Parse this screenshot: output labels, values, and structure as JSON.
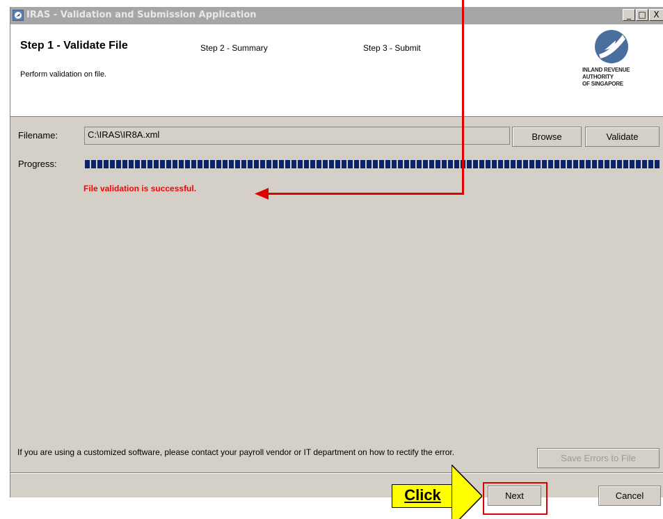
{
  "window": {
    "title": "IRAS - Validation and Submission Application",
    "controls": {
      "minimize": "_",
      "maximize": "□",
      "close": "X"
    }
  },
  "header": {
    "step1": "Step 1 - Validate File",
    "step2": "Step 2 - Summary",
    "step3": "Step 3 - Submit",
    "subtitle": "Perform validation on file.",
    "logo_lines": [
      "INLAND REVENUE",
      "AUTHORITY",
      "OF SINGAPORE"
    ]
  },
  "form": {
    "filename_label": "Filename:",
    "filename_value": "C:\\IRAS\\IR8A.xml",
    "browse_label": "Browse",
    "validate_label": "Validate",
    "progress_label": "Progress:",
    "progress_fraction": 1.0,
    "status_message": "File validation is successful."
  },
  "footer": {
    "info_text": "If you are using a customized software, please contact your payroll vendor or IT department on how to rectify the error.",
    "save_errors_label": "Save Errors to File",
    "next_label": "Next",
    "cancel_label": "Cancel"
  },
  "annotation": {
    "click_label": "Click",
    "color": "#e00000",
    "callout_color": "#ffff00"
  }
}
